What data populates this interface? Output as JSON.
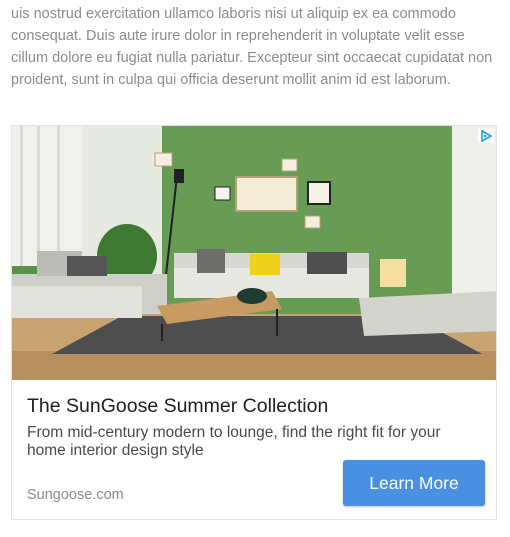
{
  "article": {
    "text": "uis nostrud exercitation ullamco laboris nisi ut aliquip ex ea commodo consequat. Duis aute irure dolor in reprehenderit in voluptate velit esse cillum dolore eu fugiat nulla pariatur. Excepteur sint occaecat cupidatat non proident, sunt in culpa qui officia deserunt mollit anim id est laborum."
  },
  "ad": {
    "image_icon": "living-room-photo",
    "adchoices_icon": "adchoices-icon",
    "title": "The SunGoose Summer Collection",
    "description": "From mid-century modern to lounge, find the right fit for your home interior design style",
    "domain": "Sungoose.com",
    "cta_label": "Learn More",
    "cta_color": "#4a90e2"
  }
}
